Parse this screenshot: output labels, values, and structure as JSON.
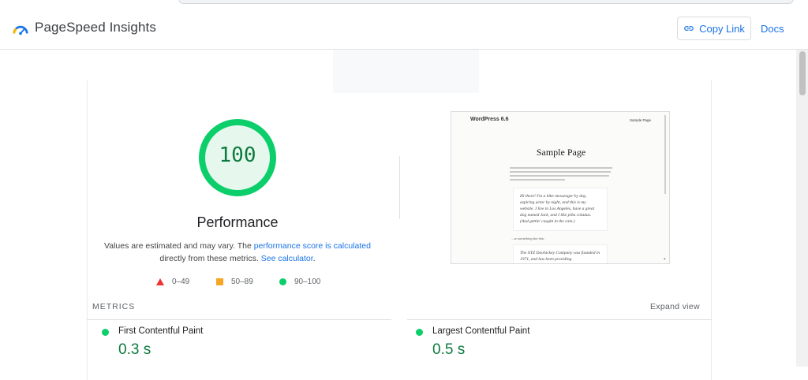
{
  "header": {
    "app_title": "PageSpeed Insights",
    "copy_link_label": "Copy Link",
    "docs_label": "Docs"
  },
  "performance": {
    "score": "100",
    "label": "Performance",
    "desc_prefix": "Values are estimated and may vary. The ",
    "desc_link1": "performance score is calculated",
    "desc_middle": " directly from these metrics. ",
    "desc_link2": "See calculator",
    "desc_suffix": ".",
    "legend": [
      {
        "range": "0–49",
        "color": "#ee3333",
        "icon": "triangle-icon"
      },
      {
        "range": "50–89",
        "color": "#f6a623",
        "icon": "square-icon"
      },
      {
        "range": "90–100",
        "color": "#0cce6b",
        "icon": "circle-icon"
      }
    ]
  },
  "screenshot": {
    "brand": "WordPress 6.6",
    "nav": "Sample Page",
    "title": "Sample Page",
    "quote1": "Hi there! I'm a bike messenger by day, aspiring actor by night, and this is my website. I live in Los Angeles, have a great dog named Jack, and I like piña coladas. (And gettin' caught in the rain.)",
    "small": "...or something like this:",
    "quote2": "The XYZ Doohickey Company was founded in 1971, and has been providing"
  },
  "metrics": {
    "section_label": "METRICS",
    "expand_label": "Expand view",
    "items": [
      {
        "name": "First Contentful Paint",
        "value": "0.3 s",
        "status_color": "#0cce6b"
      },
      {
        "name": "Largest Contentful Paint",
        "value": "0.5 s",
        "status_color": "#0cce6b"
      }
    ]
  },
  "colors": {
    "accent": "#1a73e8",
    "pass": "#0cce6b",
    "pass_text": "#0c7a3e"
  }
}
